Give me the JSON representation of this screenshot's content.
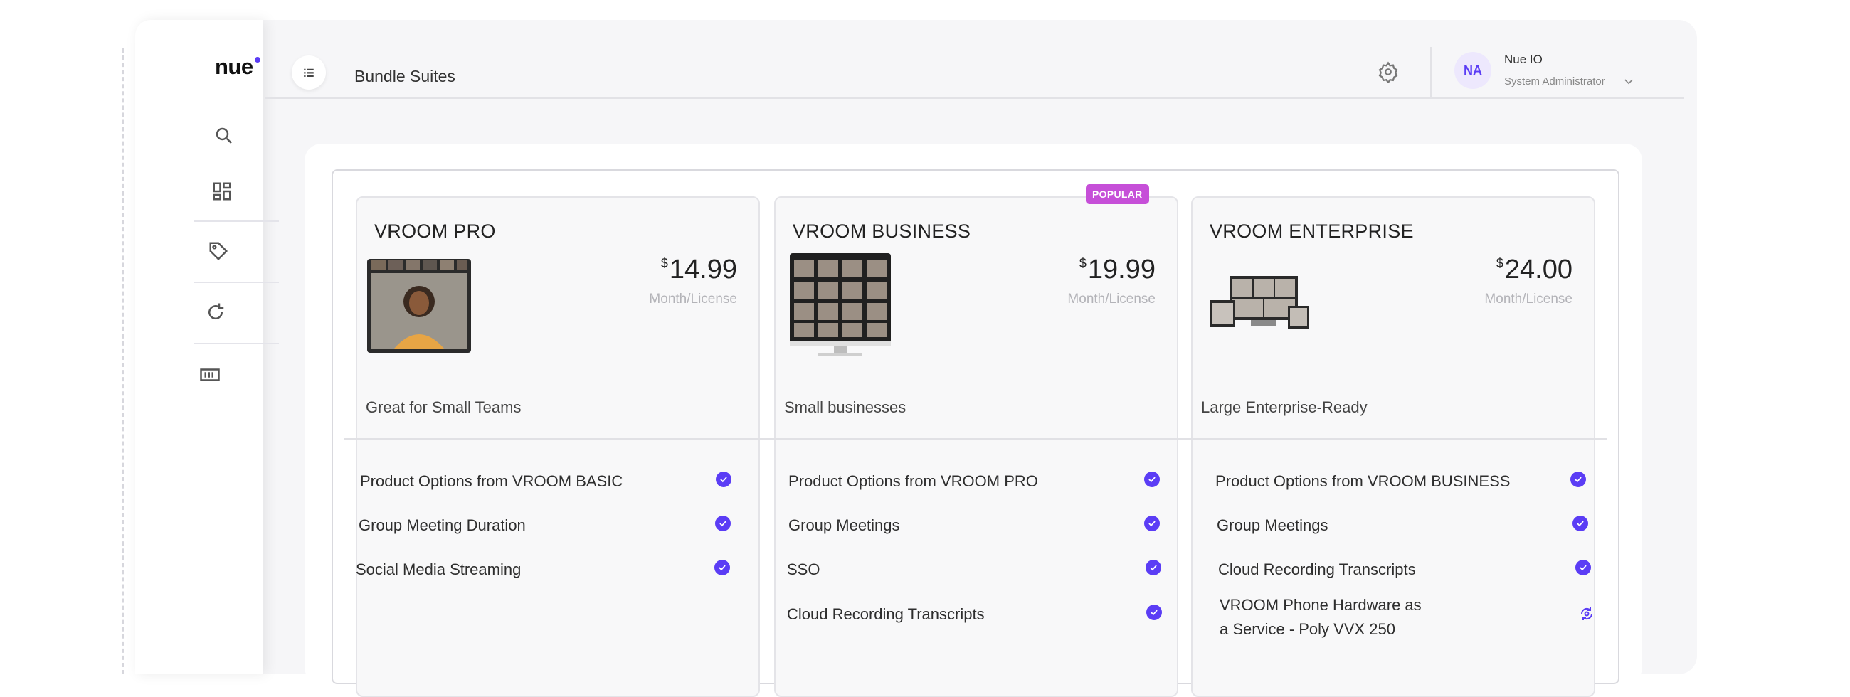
{
  "app": {
    "logo": "nue",
    "page_title": "Bundle Suites"
  },
  "user": {
    "initials": "NA",
    "name": "Nue IO",
    "role": "System Administrator"
  },
  "sidebar": {
    "items": [
      {
        "name": "search-icon"
      },
      {
        "name": "dashboard-icon"
      },
      {
        "name": "tag-icon"
      },
      {
        "name": "refresh-icon"
      },
      {
        "name": "ticket-icon"
      }
    ]
  },
  "plans": [
    {
      "name": "VROOM PRO",
      "currency": "$",
      "price": "14.99",
      "unit": "Month/License",
      "tagline": "Great for Small Teams",
      "features": [
        {
          "label": "Product Options from VROOM BASIC",
          "icon": "check-circle-icon"
        },
        {
          "label": "Group Meeting Duration",
          "icon": "check-circle-icon"
        },
        {
          "label": "Social Media Streaming",
          "icon": "check-circle-icon"
        }
      ]
    },
    {
      "name": "VROOM BUSINESS",
      "currency": "$",
      "price": "19.99",
      "unit": "Month/License",
      "tagline": "Small businesses",
      "badge": "POPULAR",
      "features": [
        {
          "label": "Product Options from VROOM PRO",
          "icon": "check-circle-icon"
        },
        {
          "label": "Group Meetings",
          "icon": "check-circle-icon"
        },
        {
          "label": "SSO",
          "icon": "check-circle-icon"
        },
        {
          "label": "Cloud Recording Transcripts",
          "icon": "check-circle-icon"
        }
      ]
    },
    {
      "name": "VROOM ENTERPRISE",
      "currency": "$",
      "price": "24.00",
      "unit": "Month/License",
      "tagline": "Large Enterprise-Ready",
      "features": [
        {
          "label": "Product Options from VROOM BUSINESS",
          "icon": "check-circle-icon"
        },
        {
          "label": "Group Meetings",
          "icon": "check-circle-icon"
        },
        {
          "label": "Cloud Recording Transcripts",
          "icon": "check-circle-icon"
        },
        {
          "label": "VROOM Phone Hardware as a Service - Poly VVX 250",
          "icon": "subscription-icon"
        }
      ]
    }
  ],
  "colors": {
    "accent": "#5b3df5",
    "badge": "#c64fd8"
  }
}
